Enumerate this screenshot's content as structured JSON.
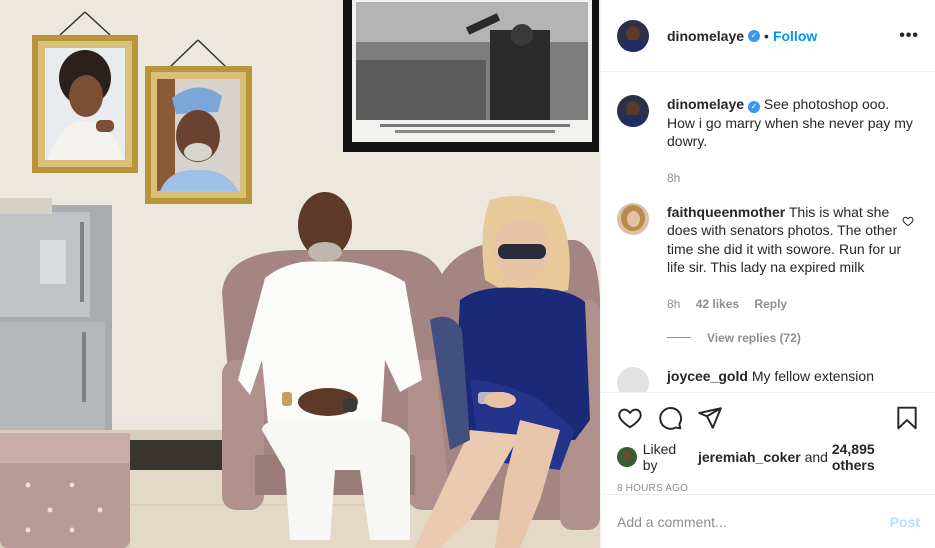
{
  "post": {
    "author": "dinomelaye",
    "follow_label": "Follow",
    "more_label": "•••",
    "caption": {
      "user": "dinomelaye",
      "text": "See photoshop ooo. How i go marry when she never pay my dowry.",
      "age": "8h"
    },
    "comments": [
      {
        "user": "faithqueenmother",
        "text": "This is what she does with senators photos. The other time she did it with sowore. Run for ur life sir. This lady na expired milk",
        "age": "8h",
        "likes": "42 likes",
        "reply_label": "Reply",
        "view_replies": "View replies (72)"
      },
      {
        "user": "joycee_gold",
        "text": "My fellow extension"
      }
    ],
    "likes": {
      "prefix": "Liked by",
      "user": "jeremiah_coker",
      "and": "and",
      "others": "24,895 others"
    },
    "timestamp": "8 HOURS AGO",
    "add_comment_placeholder": "Add a comment...",
    "post_label": "Post"
  },
  "colors": {
    "accent": "#0095f6",
    "verified": "#3897f0",
    "muted": "#8e8e8e",
    "post_disabled": "#b2dffc"
  }
}
